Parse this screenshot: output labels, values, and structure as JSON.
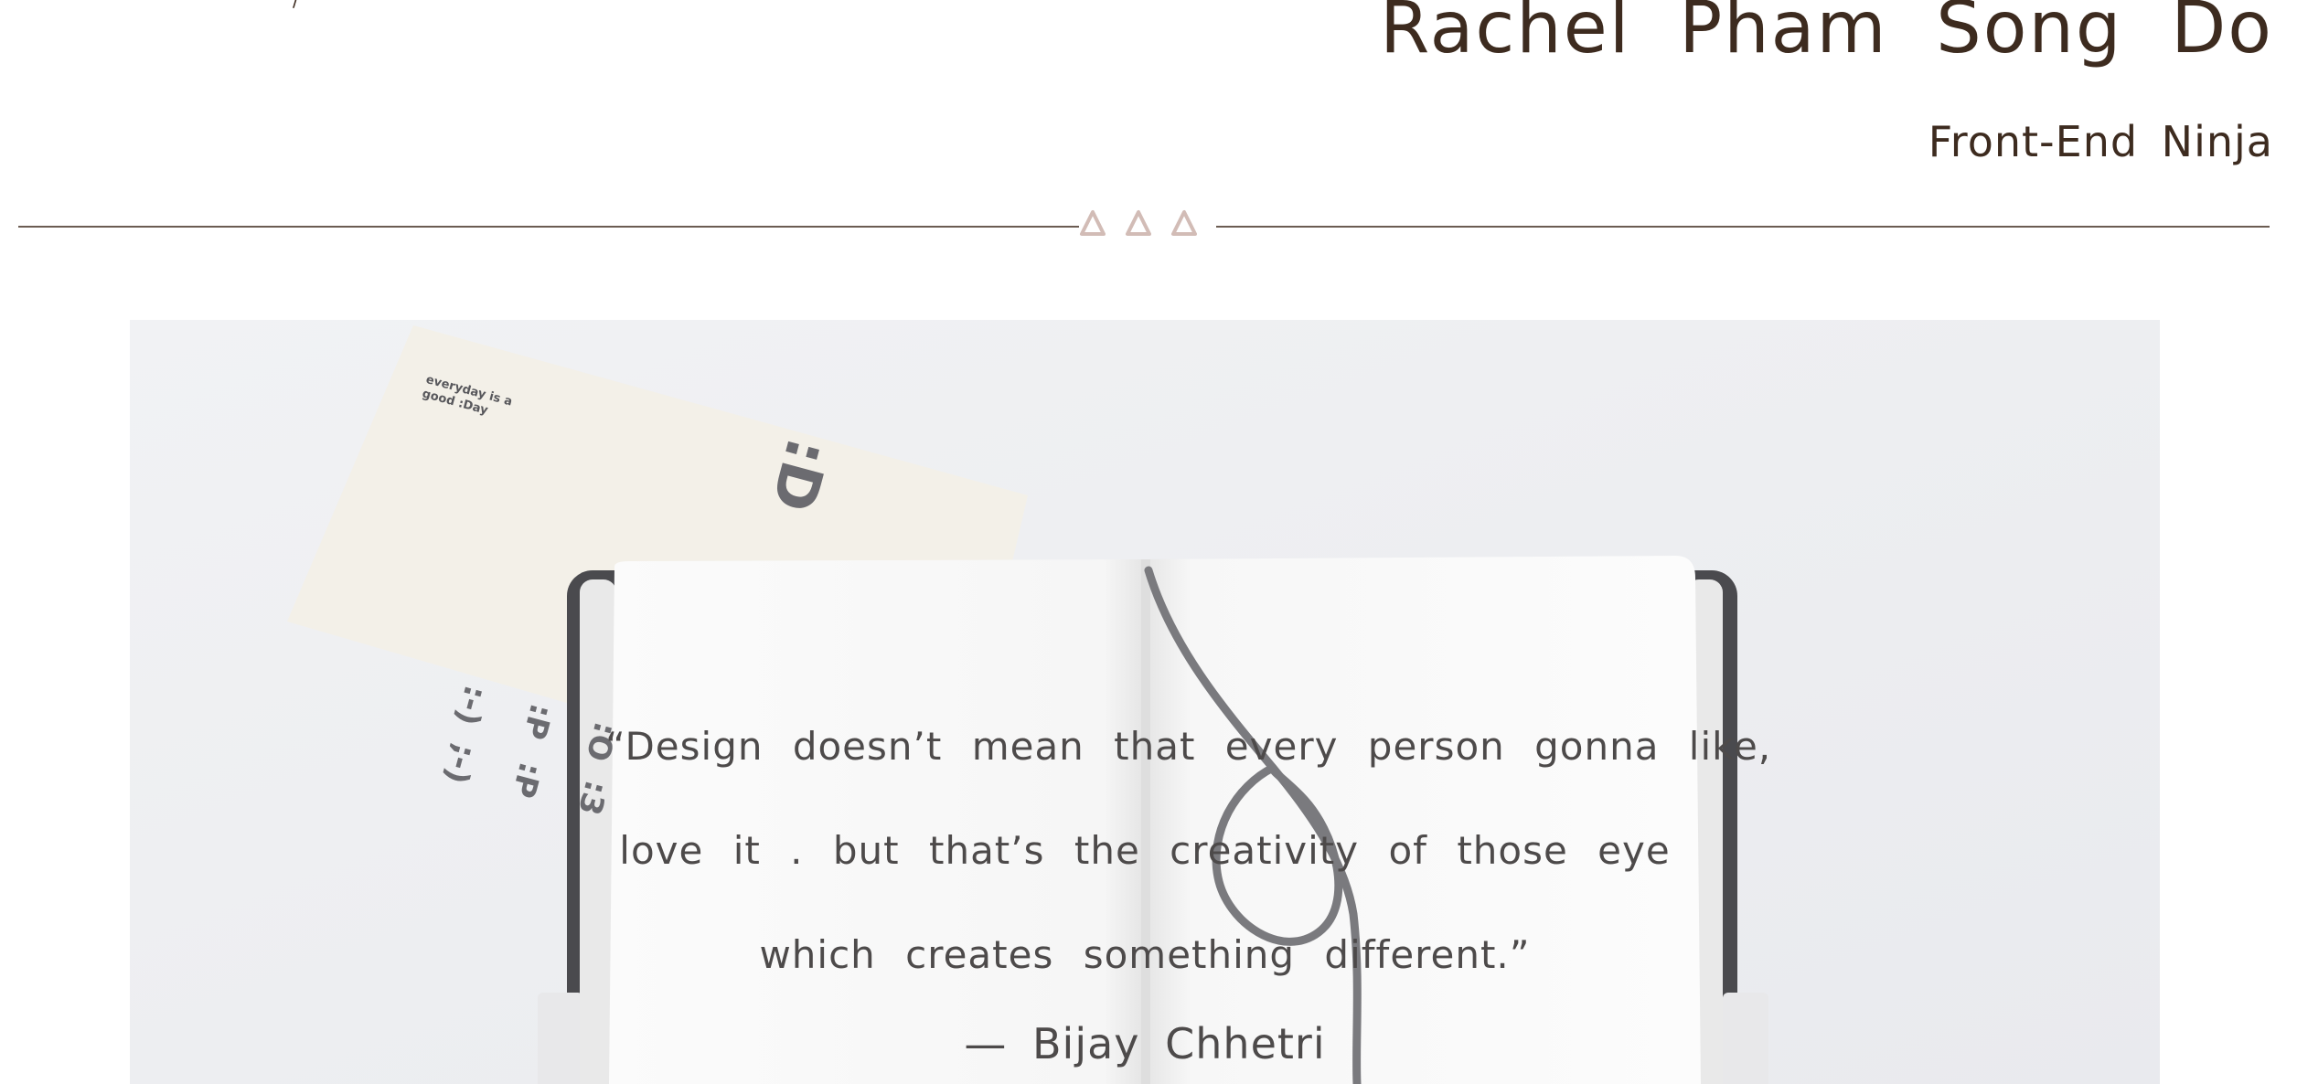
{
  "header": {
    "name": "Rachel Pham Song Do",
    "tagline": "Front-End Ninja",
    "corner_mark": "/"
  },
  "divider": {
    "ornament_icon": "triangles-ornament-icon",
    "ornament_color": "#d2bcb6",
    "line_color": "#6b5c52"
  },
  "hero": {
    "card": {
      "small_text": "everyday is a good :Day",
      "big_emoticon": ":D",
      "emoticons": [
        ":-)",
        ":P",
        ":O",
        ";-)",
        ":P",
        ":3"
      ]
    },
    "quote": {
      "lines": [
        "“Design doesn’t mean that every person gonna like,",
        "love it . but that’s the creativity of those eye",
        "which creates something different.”"
      ],
      "author": "— Bijay Chhetri"
    }
  },
  "colors": {
    "text": "#3d2b1f",
    "hero_background": "#eeeff2"
  }
}
